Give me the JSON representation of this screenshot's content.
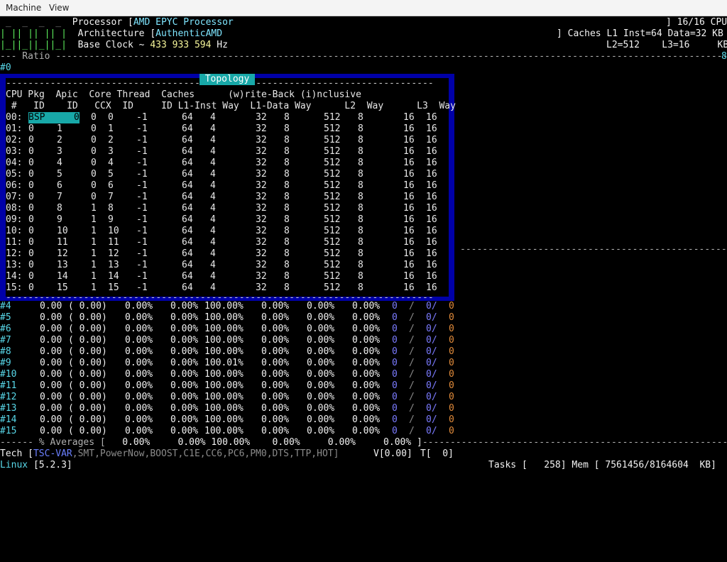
{
  "menu": {
    "machine": "Machine",
    "view": "View"
  },
  "header": {
    "processor_label": "Processor [",
    "processor_value": "AMD EPYC Processor",
    "arch_label": "Architecture [",
    "arch_value": "AuthenticAMD",
    "baseclock_label": "Base Clock ~",
    "baseclock_value": "433 933 594",
    "baseclock_unit": "Hz",
    "cpu_count": "] 16/16 CPU",
    "caches_line1": "] Caches L1 Inst=64 Data=32 KB",
    "caches_line2": "L2=512    L3=16     KB",
    "ratio_label": "--- Ratio ",
    "ratio_end": "8",
    "ratio_zero": "#0"
  },
  "topology": {
    "title": "Topology",
    "header1": "CPU Pkg  Apic  Core Thread  Caches      (w)rite-Back (i)nclusive",
    "header2": " #   ID    ID   CCX  ID     ID L1-Inst Way  L1-Data Way      L2  Way      L3  Way",
    "rows": [
      {
        "cpu": "00:",
        "pkg": "BSP",
        "apic": "0",
        "ccx": "0",
        "core": "0"
      },
      {
        "cpu": "01:",
        "pkg": "0",
        "apic": "1",
        "ccx": "0",
        "core": "1"
      },
      {
        "cpu": "02:",
        "pkg": "0",
        "apic": "2",
        "ccx": "0",
        "core": "2"
      },
      {
        "cpu": "03:",
        "pkg": "0",
        "apic": "3",
        "ccx": "0",
        "core": "3"
      },
      {
        "cpu": "04:",
        "pkg": "0",
        "apic": "4",
        "ccx": "0",
        "core": "4"
      },
      {
        "cpu": "05:",
        "pkg": "0",
        "apic": "5",
        "ccx": "0",
        "core": "5"
      },
      {
        "cpu": "06:",
        "pkg": "0",
        "apic": "6",
        "ccx": "0",
        "core": "6"
      },
      {
        "cpu": "07:",
        "pkg": "0",
        "apic": "7",
        "ccx": "0",
        "core": "7"
      },
      {
        "cpu": "08:",
        "pkg": "0",
        "apic": "8",
        "ccx": "1",
        "core": "8"
      },
      {
        "cpu": "09:",
        "pkg": "0",
        "apic": "9",
        "ccx": "1",
        "core": "9"
      },
      {
        "cpu": "10:",
        "pkg": "0",
        "apic": "10",
        "ccx": "1",
        "core": "10"
      },
      {
        "cpu": "11:",
        "pkg": "0",
        "apic": "11",
        "ccx": "1",
        "core": "11"
      },
      {
        "cpu": "12:",
        "pkg": "0",
        "apic": "12",
        "ccx": "1",
        "core": "12"
      },
      {
        "cpu": "13:",
        "pkg": "0",
        "apic": "13",
        "ccx": "1",
        "core": "13"
      },
      {
        "cpu": "14:",
        "pkg": "0",
        "apic": "14",
        "ccx": "1",
        "core": "14"
      },
      {
        "cpu": "15:",
        "pkg": "0",
        "apic": "15",
        "ccx": "1",
        "core": "15"
      }
    ],
    "thread_id": "-1",
    "l1_inst": "64",
    "l1_inst_way": "4",
    "l1_data": "32",
    "l1_data_way": "8",
    "l2": "512",
    "l2_way": "8",
    "l3": "16",
    "l3_way": "16"
  },
  "freq_rows": [
    {
      "id": "#4",
      "freq": "0.00",
      "ratio": "( 0.00)",
      "c0": "0.00%",
      "c1": "0.00%",
      "c2": "100.00%",
      "c3": "0.00%",
      "c4": "0.00%",
      "c5": "0.00%"
    },
    {
      "id": "#5",
      "freq": "0.00",
      "ratio": "( 0.00)",
      "c0": "0.00%",
      "c1": "0.00%",
      "c2": "100.00%",
      "c3": "0.00%",
      "c4": "0.00%",
      "c5": "0.00%"
    },
    {
      "id": "#6",
      "freq": "0.00",
      "ratio": "( 0.00)",
      "c0": "0.00%",
      "c1": "0.00%",
      "c2": "100.00%",
      "c3": "0.00%",
      "c4": "0.00%",
      "c5": "0.00%"
    },
    {
      "id": "#7",
      "freq": "0.00",
      "ratio": "( 0.00)",
      "c0": "0.00%",
      "c1": "0.00%",
      "c2": "100.00%",
      "c3": "0.00%",
      "c4": "0.00%",
      "c5": "0.00%"
    },
    {
      "id": "#8",
      "freq": "0.00",
      "ratio": "( 0.00)",
      "c0": "0.00%",
      "c1": "0.00%",
      "c2": "100.00%",
      "c3": "0.00%",
      "c4": "0.00%",
      "c5": "0.00%"
    },
    {
      "id": "#9",
      "freq": "0.00",
      "ratio": "( 0.00)",
      "c0": "0.00%",
      "c1": "0.00%",
      "c2": "100.01%",
      "c3": "0.00%",
      "c4": "0.00%",
      "c5": "0.00%"
    },
    {
      "id": "#10",
      "freq": "0.00",
      "ratio": "( 0.00)",
      "c0": "0.00%",
      "c1": "0.00%",
      "c2": "100.00%",
      "c3": "0.00%",
      "c4": "0.00%",
      "c5": "0.00%"
    },
    {
      "id": "#11",
      "freq": "0.00",
      "ratio": "( 0.00)",
      "c0": "0.00%",
      "c1": "0.00%",
      "c2": "100.00%",
      "c3": "0.00%",
      "c4": "0.00%",
      "c5": "0.00%"
    },
    {
      "id": "#12",
      "freq": "0.00",
      "ratio": "( 0.00)",
      "c0": "0.00%",
      "c1": "0.00%",
      "c2": "100.00%",
      "c3": "0.00%",
      "c4": "0.00%",
      "c5": "0.00%"
    },
    {
      "id": "#13",
      "freq": "0.00",
      "ratio": "( 0.00)",
      "c0": "0.00%",
      "c1": "0.00%",
      "c2": "100.00%",
      "c3": "0.00%",
      "c4": "0.00%",
      "c5": "0.00%"
    },
    {
      "id": "#14",
      "freq": "0.00",
      "ratio": "( 0.00)",
      "c0": "0.00%",
      "c1": "0.00%",
      "c2": "100.00%",
      "c3": "0.00%",
      "c4": "0.00%",
      "c5": "0.00%"
    },
    {
      "id": "#15",
      "freq": "0.00",
      "ratio": "( 0.00)",
      "c0": "0.00%",
      "c1": "0.00%",
      "c2": "100.00%",
      "c3": "0.00%",
      "c4": "0.00%",
      "c5": "0.00%"
    }
  ],
  "temp_vals": {
    "t1": "0",
    "slash": "/",
    "t2": "0/",
    "t3": "0"
  },
  "averages": {
    "label": "------ % Averages [",
    "values": "   0.00%     0.00% 100.00%    0.00%     0.00%     0.00% ]"
  },
  "tech": {
    "label": "Tech [",
    "tsc": "TSC-VAR",
    "rest": ",SMT,PowerNow,BOOST,C1E,CC6,PC6,PM0,DTS,TTP,HOT]",
    "v": "V[0.00]",
    "t": "T[  0]"
  },
  "status": {
    "os": "Linux",
    "kernel": "[5.2.3]",
    "tasks_label": "Tasks [",
    "tasks_value": "258",
    "mem_label": "] Mem [",
    "mem_value": "7561456/8164604",
    "mem_unit": "KB]"
  },
  "colors": {
    "topology_frame": "#0000a8",
    "accent_cyan": "#18a8a8",
    "menubar": "#f4f4f4"
  }
}
